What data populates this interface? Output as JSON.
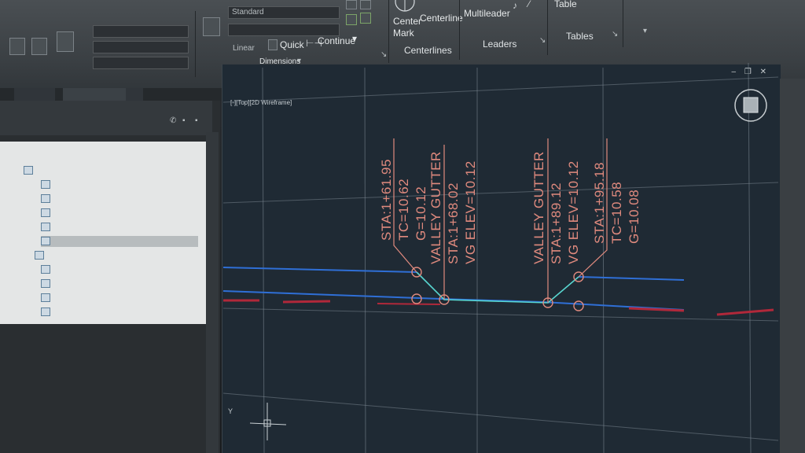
{
  "ribbon": {
    "dimensions": {
      "style_value": "Standard",
      "quick_label": "Quick",
      "continue_label": "Continue",
      "linear_label": "Linear",
      "panel_title": "Dimensions"
    },
    "centerlines": {
      "center_mark_label": "Center\nMark",
      "centerline_label": "Centerline",
      "panel_title": "Centerlines"
    },
    "leaders": {
      "multileader_label": "Multileader",
      "panel_title": "Leaders"
    },
    "tables": {
      "table_label": "Table",
      "panel_title": "Tables"
    }
  },
  "viewport": {
    "label": "[-][Top][2D Wireframe]"
  },
  "annotations": [
    {
      "id": "label-1",
      "lines": [
        "STA:1+61.95",
        "TC=10.62",
        "G=10.12"
      ]
    },
    {
      "id": "label-2",
      "lines": [
        "VALLEY GUTTER",
        "STA:1+68.02",
        "VG  ELEV=10.12"
      ]
    },
    {
      "id": "label-3",
      "lines": [
        "VALLEY GUTTER",
        "STA:1+89.12",
        "VG  ELEV=10.12"
      ]
    },
    {
      "id": "label-4",
      "lines": [
        "STA:1+95.18",
        "TC=10.58",
        "G=10.08"
      ]
    }
  ],
  "colors": {
    "annotation_text": "#e08a7e",
    "leader_line": "#58d6d0",
    "profile_blue": "#2f6fd6",
    "profile_red": "#b0283a",
    "grid": "#7f8b95",
    "canvas_bg": "#1f2a34"
  },
  "icons": [
    "dimension-icon",
    "center-mark-icon",
    "multileader-icon",
    "table-icon",
    "viewcube-icon",
    "ucs-icon"
  ]
}
